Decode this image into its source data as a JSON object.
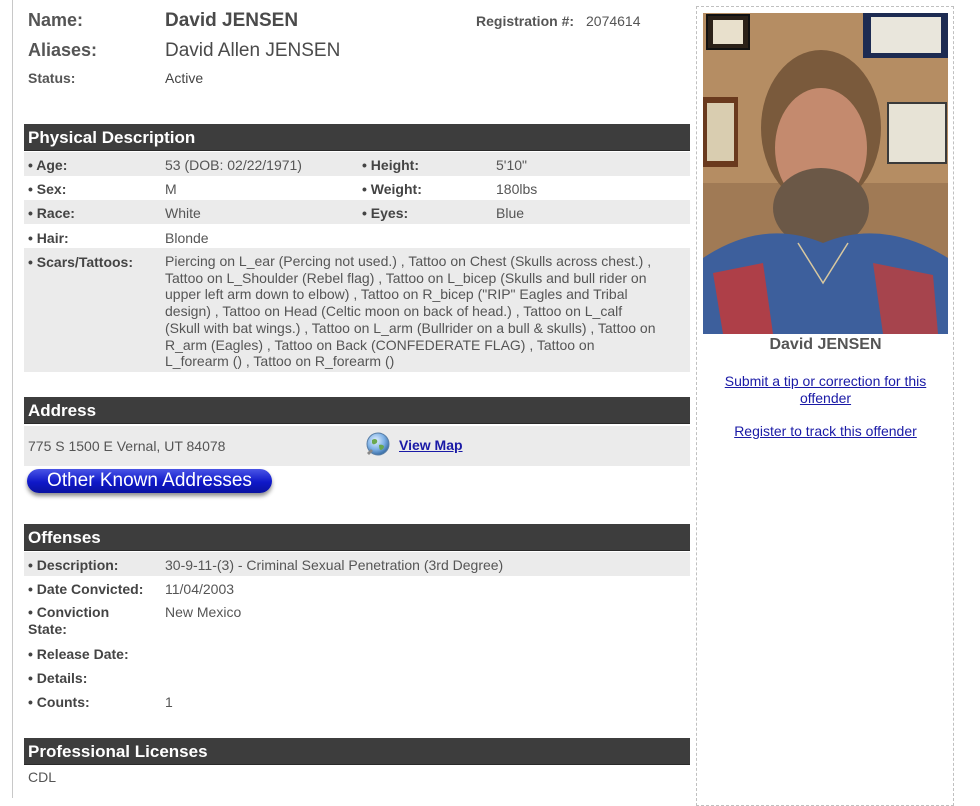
{
  "header": {
    "name_label": "Name:",
    "name_value": "David JENSEN",
    "aliases_label": "Aliases:",
    "aliases_value": "David Allen JENSEN",
    "status_label": "Status:",
    "status_value": "Active",
    "registration_label": "Registration #:",
    "registration_value": "2074614"
  },
  "physical": {
    "title": "Physical Description",
    "age_label": "• Age:",
    "age_value": "53  (DOB: 02/22/1971)",
    "height_label": "• Height:",
    "height_value": "5'10\"",
    "sex_label": "• Sex:",
    "sex_value": "M",
    "weight_label": "• Weight:",
    "weight_value": "180lbs",
    "race_label": "• Race:",
    "race_value": "White",
    "eyes_label": "• Eyes:",
    "eyes_value": "Blue",
    "hair_label": "• Hair:",
    "hair_value": "Blonde",
    "scars_label": "• Scars/Tattoos:",
    "scars_lines": [
      "Piercing on L_ear (Percing not used.) , Tattoo on Chest (Skulls across chest.) ,",
      "Tattoo on L_Shoulder (Rebel flag) , Tattoo on L_bicep (Skulls and bull rider on",
      "upper left arm down to elbow) , Tattoo on R_bicep (\"RIP\" Eagles and Tribal",
      "design) , Tattoo on Head (Celtic moon on back of head.) , Tattoo on L_calf",
      "(Skull with bat wings.) , Tattoo on L_arm (Bullrider on a bull & skulls) , Tattoo on",
      "R_arm (Eagles) , Tattoo on Back (CONFEDERATE FLAG) , Tattoo on",
      "L_forearm () , Tattoo on R_forearm ()"
    ]
  },
  "address": {
    "title": "Address",
    "value": "775 S 1500 E Vernal, UT 84078",
    "map_link": "View Map",
    "other_button": "Other Known Addresses"
  },
  "offenses": {
    "title": "Offenses",
    "description_label": "• Description:",
    "description_value": "30-9-11-(3) - Criminal Sexual Penetration (3rd Degree)",
    "convicted_label": "• Date Convicted:",
    "convicted_value": "11/04/2003",
    "state_label_1": "• Conviction",
    "state_label_2": "State:",
    "state_value": "New Mexico",
    "release_label": "• Release Date:",
    "details_label": "• Details:",
    "counts_label": "• Counts:",
    "counts_value": "1"
  },
  "licenses": {
    "title": "Professional Licenses",
    "value": "CDL"
  },
  "sidebar": {
    "photo_caption": "David JENSEN",
    "tip_link_line1": "Submit a tip or correction for this",
    "tip_link_line2": "offender",
    "track_link": "Register to track this offender"
  },
  "icons": {
    "map": "globe-icon"
  },
  "colors": {
    "section_bar": "#3d3d3d",
    "row_shade": "#ebebeb",
    "link": "#1a1aa6",
    "button_blue": "#0f18c8"
  }
}
